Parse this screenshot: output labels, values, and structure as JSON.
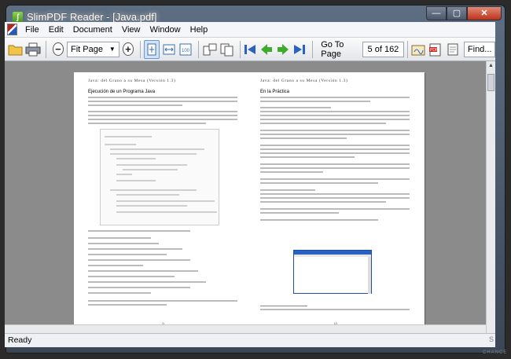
{
  "window": {
    "title": "SlimPDF Reader - [Java.pdf]"
  },
  "caption": {
    "minimize": "—",
    "maximize": "▢",
    "close": "✕"
  },
  "menu": [
    "File",
    "Edit",
    "Document",
    "View",
    "Window",
    "Help"
  ],
  "toolbar": {
    "zoom_mode": "Fit Page",
    "go_to_page_label": "Go To Page",
    "page_indicator": "5 of 162",
    "find_placeholder": "Find..."
  },
  "status": {
    "text": "Ready"
  },
  "pages": {
    "left": {
      "header": "Java: del Grano a su Mesa (Versión 1.3)",
      "section_title": "Ejecución de un Programa Java",
      "page_number": "9"
    },
    "right": {
      "header": "Java: del Grano a su Mesa (Versión 1.3)",
      "section_title": "En la Práctica",
      "page_number": "10"
    }
  },
  "watermark": {
    "text": "S",
    "sub": "CHANCE"
  }
}
